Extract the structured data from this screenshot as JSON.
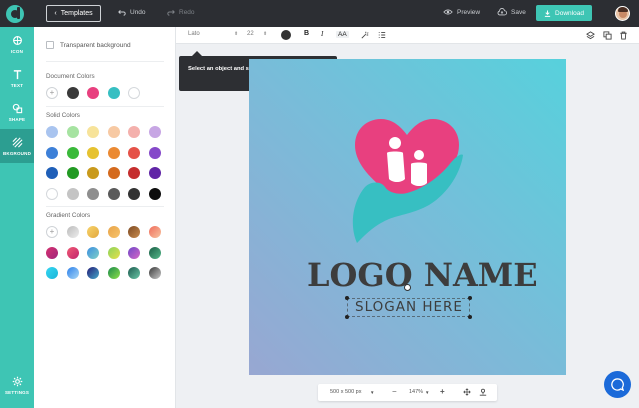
{
  "topbar": {
    "templates_label": "Templates",
    "undo_label": "Undo",
    "redo_label": "Redo",
    "preview_label": "Preview",
    "save_label": "Save",
    "download_label": "Download"
  },
  "nav": {
    "icon_label": "ICON",
    "text_label": "TEXT",
    "shape_label": "SHAPE",
    "background_label": "BKGROUND",
    "settings_label": "SETTINGS"
  },
  "panel": {
    "transparent_label": "Transparent background",
    "document_colors_label": "Document Colors",
    "solid_colors_label": "Solid Colors",
    "gradient_colors_label": "Gradient Colors",
    "plus_symbol": "+",
    "document_colors": [
      "#3a3a3a",
      "#e8407f",
      "#37bfc2",
      "#ffffff"
    ],
    "solid_colors": [
      [
        "#a9c4ef",
        "#a6e3a1",
        "#f7e39a",
        "#f7c9a3",
        "#f4b0ac",
        "#c7a6e4"
      ],
      [
        "#3d80d8",
        "#3ab93a",
        "#e6c230",
        "#eb8a33",
        "#e55248",
        "#8549c9"
      ],
      [
        "#1f5fb8",
        "#229a23",
        "#c99a1c",
        "#d46a1e",
        "#c52e2e",
        "#6025a6"
      ],
      [
        "#ffffff",
        "#c4c4c4",
        "#8e8e8e",
        "#5a5a5a",
        "#333333",
        "#0d0d0d"
      ]
    ],
    "gradient_colors": [
      [
        "",
        "linear-gradient(135deg,#bbbbbb,#eeeeee)",
        "linear-gradient(135deg,#f7d36b,#e2a83e)",
        "linear-gradient(135deg,#e8a44a,#f7c46b)",
        "linear-gradient(135deg,#7d4a24,#c88c4e)",
        "linear-gradient(135deg,#f06d5c,#f7c4a0)"
      ],
      [
        "linear-gradient(135deg,#d6326f,#a0247c)",
        "linear-gradient(135deg,#f05a74,#c2246e)",
        "linear-gradient(135deg,#3c8ee0,#7fd0c8)",
        "linear-gradient(135deg,#8dd35c,#e6e04a)",
        "linear-gradient(135deg,#7047c8,#d468c6)",
        "linear-gradient(135deg,#1b5e46,#55b98a)"
      ],
      [
        "linear-gradient(135deg,#35d6f2,#1ab5d8)",
        "linear-gradient(135deg,#2d80ea,#a8d8f7)",
        "linear-gradient(135deg,#251d78,#44a8c8)",
        "linear-gradient(135deg,#1c8a4c,#8de04a)",
        "linear-gradient(135deg,#1e5b50,#69c6a6)",
        "linear-gradient(135deg,#3a3a3a,#c9c9c9)"
      ]
    ]
  },
  "format": {
    "font_name": "Lato",
    "font_size": "22",
    "bold": "B",
    "italic": "I",
    "case": "AA"
  },
  "tooltip": {
    "text": "Select an object and set its basic properties here."
  },
  "canvas": {
    "logo_name": "LOGO NAME",
    "slogan": "SLOGAN HERE"
  },
  "zoombar": {
    "size_label": "500 x 500 px",
    "zoom_label": "147%",
    "minus": "−",
    "plus": "+"
  },
  "colors": {
    "accent": "#3ec5b4",
    "topbar": "#2c2e33",
    "heart": "#e8407f",
    "hand": "#37bfc2",
    "chat": "#1b6ad9"
  }
}
